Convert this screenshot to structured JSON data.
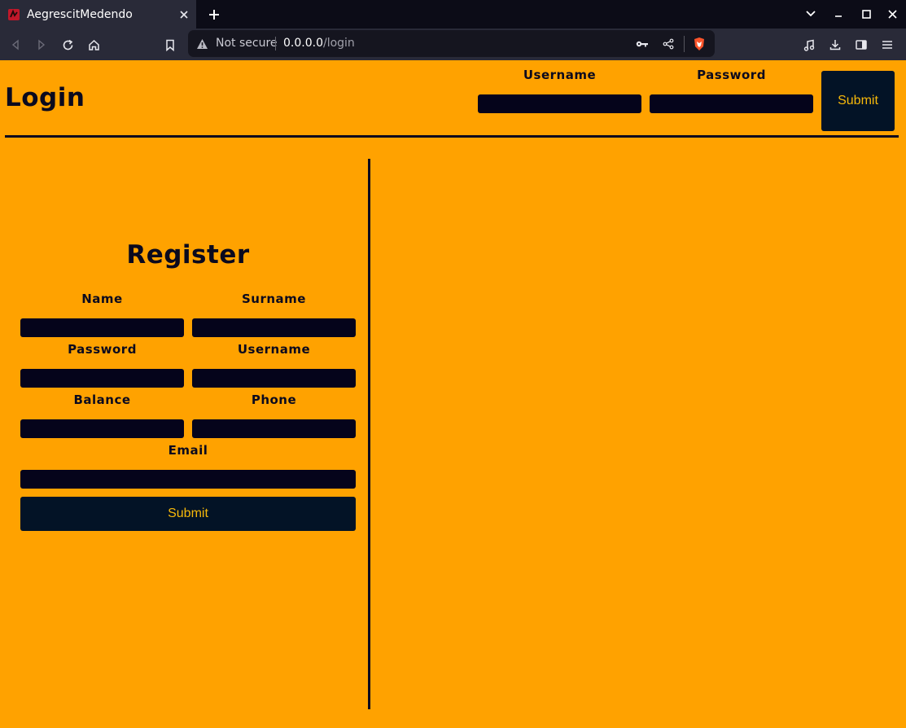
{
  "browser": {
    "tab_title": "AegrescitMedendo",
    "security_label": "Not secure",
    "url_host": "0.0.0.0",
    "url_path": "/login"
  },
  "header": {
    "title": "Login",
    "username_label": "Username",
    "password_label": "Password",
    "username_value": "",
    "password_value": "",
    "submit_label": "Submit"
  },
  "register": {
    "title": "Register",
    "name_label": "Name",
    "surname_label": "Surname",
    "password_label": "Password",
    "username_label": "Username",
    "balance_label": "Balance",
    "phone_label": "Phone",
    "email_label": "Email",
    "submit_label": "Submit"
  },
  "colors": {
    "page_background": "#ffa200",
    "input_background": "#05041b",
    "button_background": "#031326",
    "button_text": "#f7b90a",
    "text": "#0b0a1e"
  }
}
